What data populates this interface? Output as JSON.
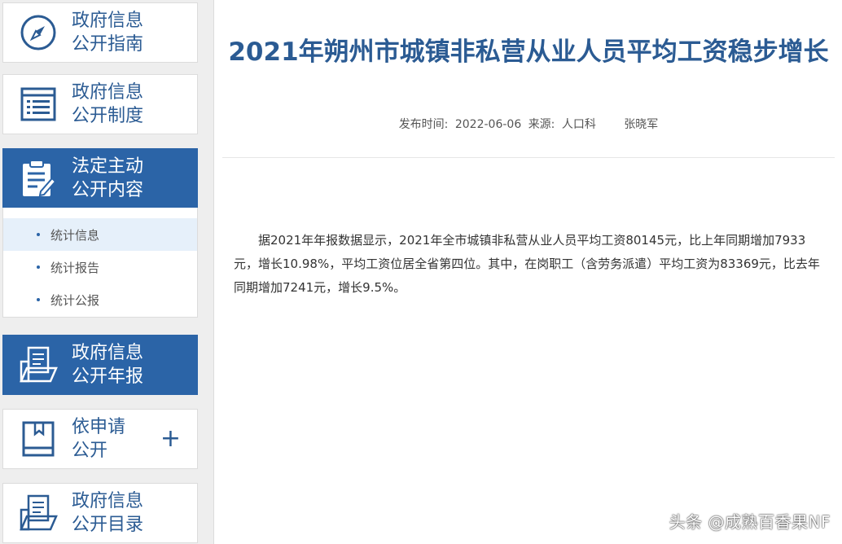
{
  "sidebar": {
    "guide": {
      "line1": "政府信息",
      "line2": "公开指南",
      "icon": "compass-icon"
    },
    "system": {
      "line1": "政府信息",
      "line2": "公开制度",
      "icon": "list-icon"
    },
    "statutory": {
      "line1": "法定主动",
      "line2": "公开内容",
      "icon": "clipboard-edit-icon"
    },
    "sub_items": [
      {
        "label": "统计信息"
      },
      {
        "label": "统计报告"
      },
      {
        "label": "统计公报"
      }
    ],
    "annual": {
      "line1": "政府信息",
      "line2": "公开年报",
      "icon": "folder-document-icon"
    },
    "apply": {
      "line1": "依申请",
      "line2": "公开",
      "icon": "book-icon",
      "plus": "+"
    },
    "catalog": {
      "line1": "政府信息",
      "line2": "公开目录",
      "icon": "folder-document-icon"
    }
  },
  "article": {
    "title": "2021年朔州市城镇非私营从业人员平均工资稳步增长",
    "publish_label": "发布时间:",
    "publish_date": "2022-06-06",
    "source_label": "来源:",
    "source": "人口科",
    "author": "张晓军",
    "body": "据2021年年报数据显示，2021年全市城镇非私营从业人员平均工资80145元，比上年同期增加7933元，增长10.98%，平均工资位居全省第四位。其中，在岗职工（含劳务派遣）平均工资为83369元，比去年同期增加7241元，增长9.5%。"
  },
  "watermark": "头条 @成熟百香果NF",
  "colors": {
    "brand": "#2b64a7",
    "text_blue": "#2b5b93"
  }
}
